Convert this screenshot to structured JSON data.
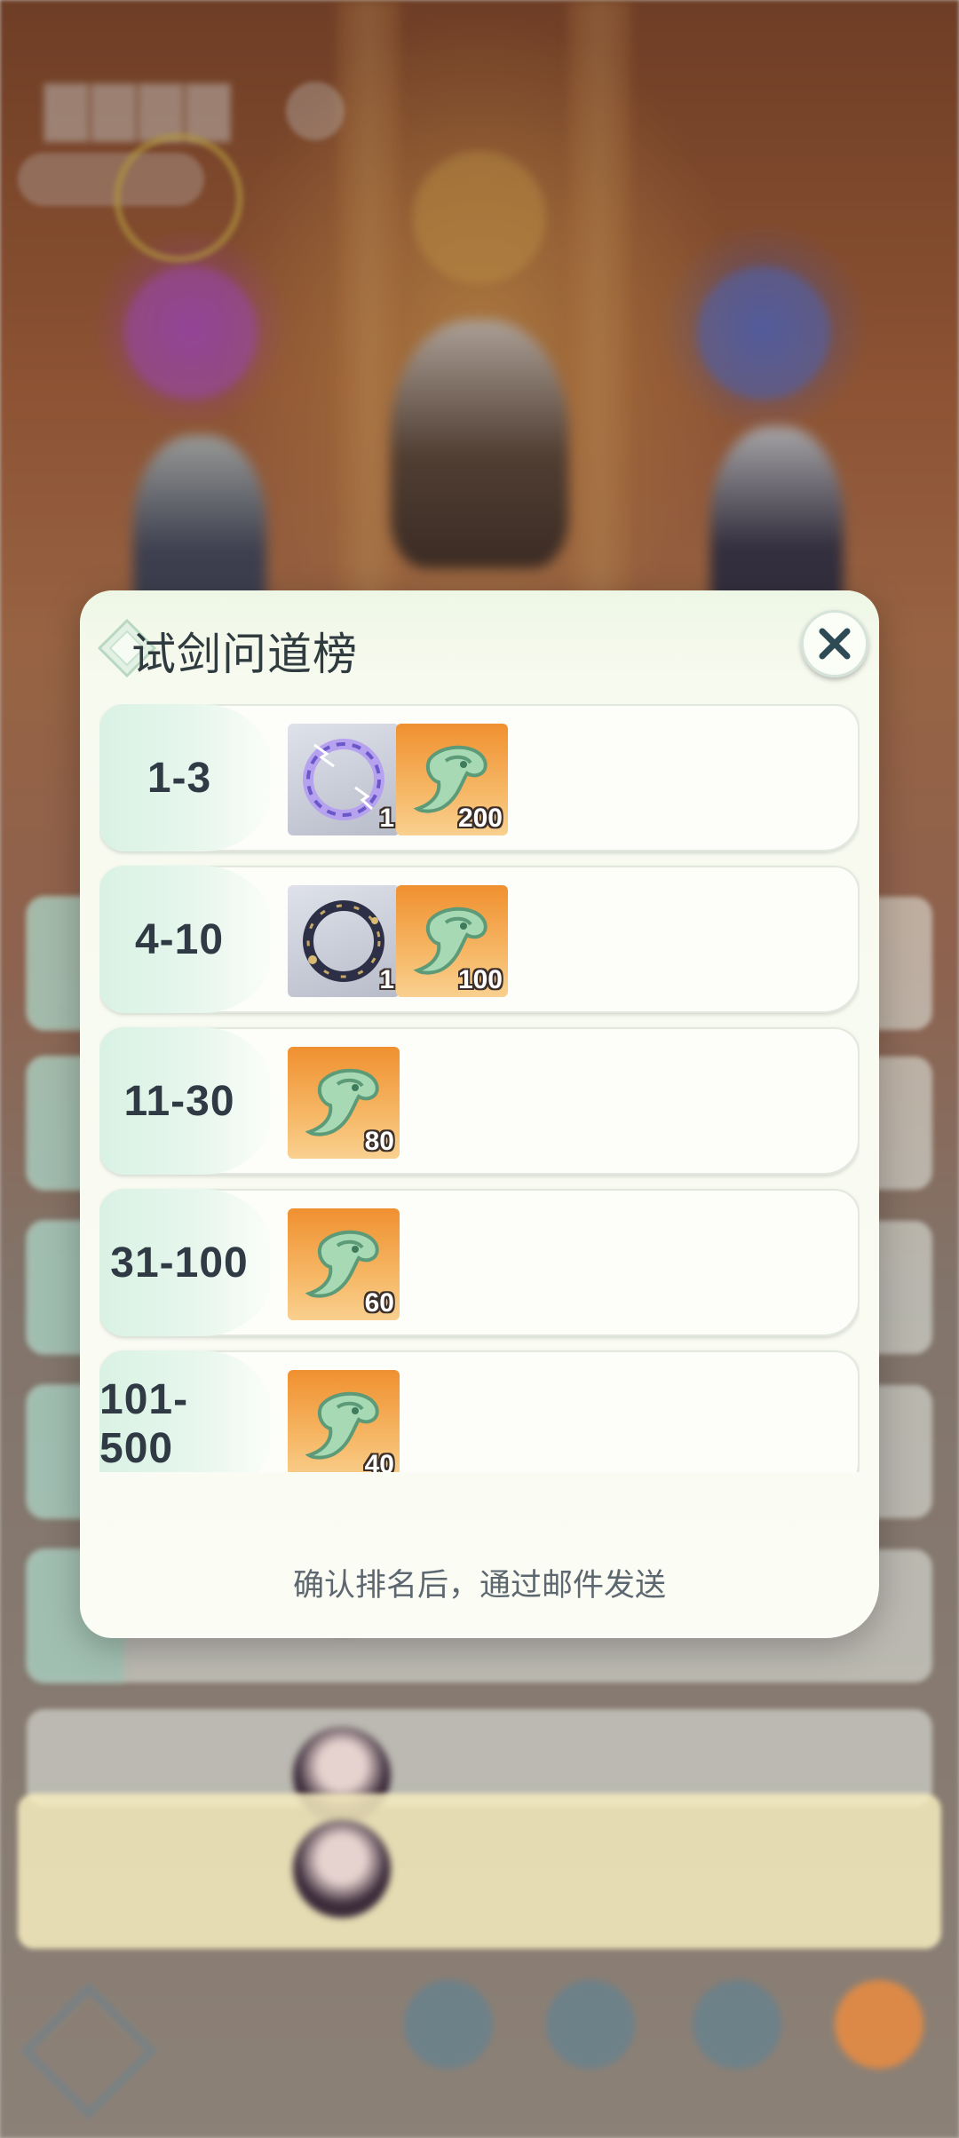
{
  "dialog": {
    "title": "试剑问道榜",
    "close_icon": "close-x-icon",
    "footer_note": "确认排名后，通过邮件发送"
  },
  "reward_tiers": [
    {
      "rank": "1-3",
      "items": [
        {
          "icon": "purple-lightning-ring-icon",
          "count": "1"
        },
        {
          "icon": "jade-token-icon",
          "count": "200"
        }
      ]
    },
    {
      "rank": "4-10",
      "items": [
        {
          "icon": "dark-gold-ring-icon",
          "count": "1"
        },
        {
          "icon": "jade-token-icon",
          "count": "100"
        }
      ]
    },
    {
      "rank": "11-30",
      "items": [
        {
          "icon": "jade-token-icon",
          "count": "80"
        }
      ]
    },
    {
      "rank": "31-100",
      "items": [
        {
          "icon": "jade-token-icon",
          "count": "60"
        }
      ]
    },
    {
      "rank": "101-500",
      "items": [
        {
          "icon": "jade-token-icon",
          "count": "40"
        }
      ]
    }
  ],
  "colors": {
    "dialog_bg": "#fbfcf4",
    "rank_text": "#2f3a44",
    "rank_zone": "#d9f2e4",
    "item_orange": "#f09030",
    "item_gray": "#b8bcc9"
  }
}
